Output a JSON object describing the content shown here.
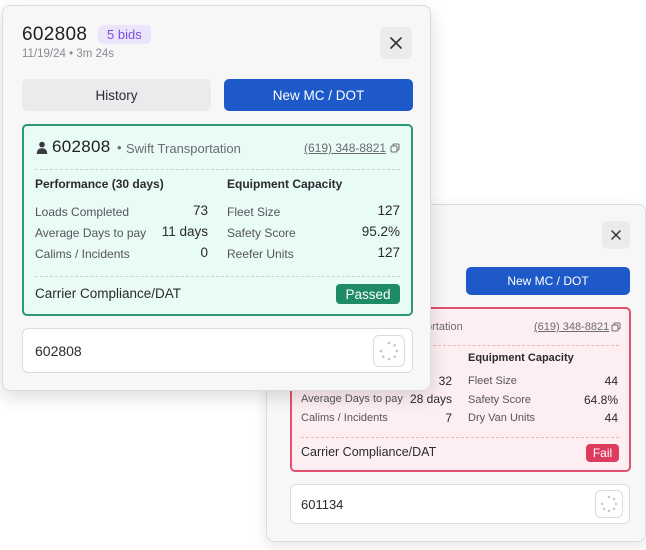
{
  "front": {
    "header": {
      "title": "602808",
      "badge": "5 bids",
      "subtitle": "11/19/24 • 3m 24s"
    },
    "buttons": {
      "history": "History",
      "new_mc": "New MC / DOT"
    },
    "card": {
      "carrier_id": "602808",
      "separator": "•",
      "carrier_name": "Swift Transportation",
      "phone": "(619) 348-8821",
      "performance_title": "Performance (30 days)",
      "equipment_title": "Equipment Capacity",
      "performance": [
        {
          "label": "Loads Completed",
          "value": "73"
        },
        {
          "label": "Average Days to pay",
          "value": "11 days"
        },
        {
          "label": "Calims / Incidents",
          "value": "0"
        }
      ],
      "equipment": [
        {
          "label": "Fleet Size",
          "value": "127"
        },
        {
          "label": "Safety Score",
          "value": "95.2%"
        },
        {
          "label": "Reefer Units",
          "value": "127"
        }
      ],
      "compliance_label": "Carrier Compliance/DAT",
      "status": "Passed"
    },
    "input_value": "602808"
  },
  "back": {
    "buttons": {
      "new_mc": "New MC / DOT"
    },
    "card": {
      "carrier_name_partial": "ortation",
      "phone": "(619) 348-8821",
      "equipment_title": "Equipment Capacity",
      "performance": [
        {
          "label": "",
          "value": "32"
        },
        {
          "label": "Average Days to pay",
          "value": "28 days"
        },
        {
          "label": "Calims / Incidents",
          "value": "7"
        }
      ],
      "equipment": [
        {
          "label": "Fleet Size",
          "value": "44"
        },
        {
          "label": "Safety Score",
          "value": "64.8%"
        },
        {
          "label": "Dry Van Units",
          "value": "44"
        }
      ],
      "compliance_label": "Carrier Compliance/DAT",
      "status": "Fail"
    },
    "input_value": "601134"
  },
  "colors": {
    "primary_blue": "#1d59c8",
    "pass_green": "#1f8a66",
    "fail_red": "#dc3d5e",
    "badge_purple": "#7c4fe0"
  }
}
